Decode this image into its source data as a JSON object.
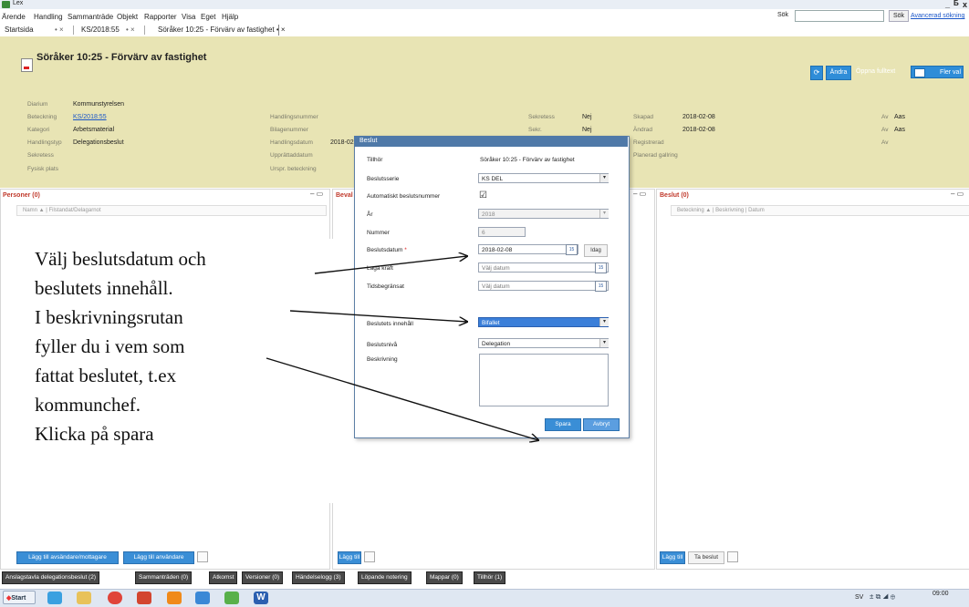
{
  "window": {
    "title": "Lex",
    "minimize": "_",
    "restore": "Б",
    "close": "x"
  },
  "menu": [
    "Ärende",
    "Handling",
    "Sammanträde",
    "Objekt",
    "Rapporter",
    "Visa",
    "Eget",
    "Hjälp"
  ],
  "search": {
    "label": "Sök",
    "value": "",
    "button": "Sök",
    "advanced": "Avancerad sökning"
  },
  "tabs": [
    "Startsida",
    "• ×",
    "KS/2018:55",
    "• ×",
    "Söråker 10:25 - Förvärv av fastighet • ×"
  ],
  "record": {
    "title": "Söråker 10:25 - Förvärv av fastighet",
    "buttons": {
      "change": "Ändra",
      "open_fulltext": "Öppna fulltext",
      "more": "Fler val"
    },
    "fields_left": [
      {
        "label": "Diarium",
        "value": "Kommunstyrelsen"
      },
      {
        "label": "Beteckning",
        "value": "KS/2018:55",
        "link": true
      },
      {
        "label": "Kategori",
        "value": "Arbetsmaterial"
      },
      {
        "label": "Handlingstyp",
        "value": "Delegationsbeslut"
      },
      {
        "label": "Sekretess",
        "value": ""
      },
      {
        "label": "Fysisk plats",
        "value": ""
      }
    ],
    "fields_mid": [
      {
        "label": "Handlingsnummer",
        "value": ""
      },
      {
        "label": "Bilagenummer",
        "value": ""
      },
      {
        "label": "Handlingsdatum",
        "value": "2018-02"
      },
      {
        "label": "Upprättaddatum",
        "value": ""
      },
      {
        "label": "Urspr. beteckning",
        "value": ""
      }
    ],
    "fields_right": [
      {
        "label": "Sekretess",
        "value": "Nej"
      },
      {
        "label": "Sekr.",
        "value": "Nej"
      }
    ],
    "fields_far": [
      {
        "label": "Skapad",
        "value": "2018-02-08"
      },
      {
        "label": "Ändrad",
        "value": "2018-02-08"
      },
      {
        "label": "Registrerad",
        "value": ""
      },
      {
        "label": "Planerad gallring",
        "value": ""
      }
    ],
    "fields_av": [
      {
        "label": "Av",
        "value": "Aas"
      },
      {
        "label": "Av",
        "value": "Aas"
      },
      {
        "label": "Av",
        "value": ""
      }
    ]
  },
  "panels": {
    "personer": {
      "title": "Personer (0)",
      "columns": "Namn ▲ | Filstandat/Delagarnot",
      "btn1": "Lägg till avsändare/mottagare",
      "btn2": "Lägg till användare"
    },
    "bevakning": {
      "title": "Beval",
      "btn1": "Lägg till"
    },
    "beslut": {
      "title": "Beslut (0)",
      "columns": "Beteckning ▲ | Beskrivning | Datum",
      "btn1": "Lägg till",
      "btn2": "Ta beslut"
    }
  },
  "bottom_tabs": [
    "Anslagstavla delegationsbeslut (2)",
    "Sammanträden (0)",
    "Atkomst",
    "Versioner (0)",
    "Händelselogg (3)",
    "Löpande notering",
    "Mappar (0)",
    "Tillhör (1)"
  ],
  "dialog": {
    "title": "Beslut",
    "tillhor_label": "Tillhör",
    "tillhor_value": "Söråker 10:25 - Förvärv av fastighet",
    "beslutsserie_label": "Beslutsserie",
    "beslutsserie_value": "KS DEL",
    "auto_label": "Automatiskt beslutsnummer",
    "auto_checked": "☑",
    "ar_label": "År",
    "ar_value": "2018",
    "nummer_label": "Nummer",
    "nummer_value": "6",
    "datum_label": "Beslutsdatum",
    "datum_required": "*",
    "datum_value": "2018-02-08",
    "idag": "Idag",
    "laga_label": "Laga kraft",
    "laga_placeholder": "Välj datum",
    "tids_label": "Tidsbegränsat",
    "tids_placeholder": "Välj datum",
    "innehall_label": "Beslutets innehåll",
    "innehall_value": "Bifallet",
    "niva_label": "Beslutsnivå",
    "niva_value": "Delegation",
    "beskrivning_label": "Beskrivning",
    "save": "Spara",
    "cancel": "Avbryt",
    "cal_icon": "15"
  },
  "instruction_lines": [
    "Välj beslutsdatum och",
    "beslutets innehåll.",
    "I beskrivningsrutan",
    "fyller du i vem som",
    "fattat beslutet, t.ex",
    "kommunchef.",
    "Klicka på spara"
  ],
  "taskbar": {
    "start": "Start",
    "lang": "SV",
    "time": "09:00"
  },
  "colors": {
    "header_bg": "#e8e4b4",
    "accent": "#2f8dd8",
    "dialog_title": "#4f79a8",
    "selected": "#3b7fd9"
  }
}
